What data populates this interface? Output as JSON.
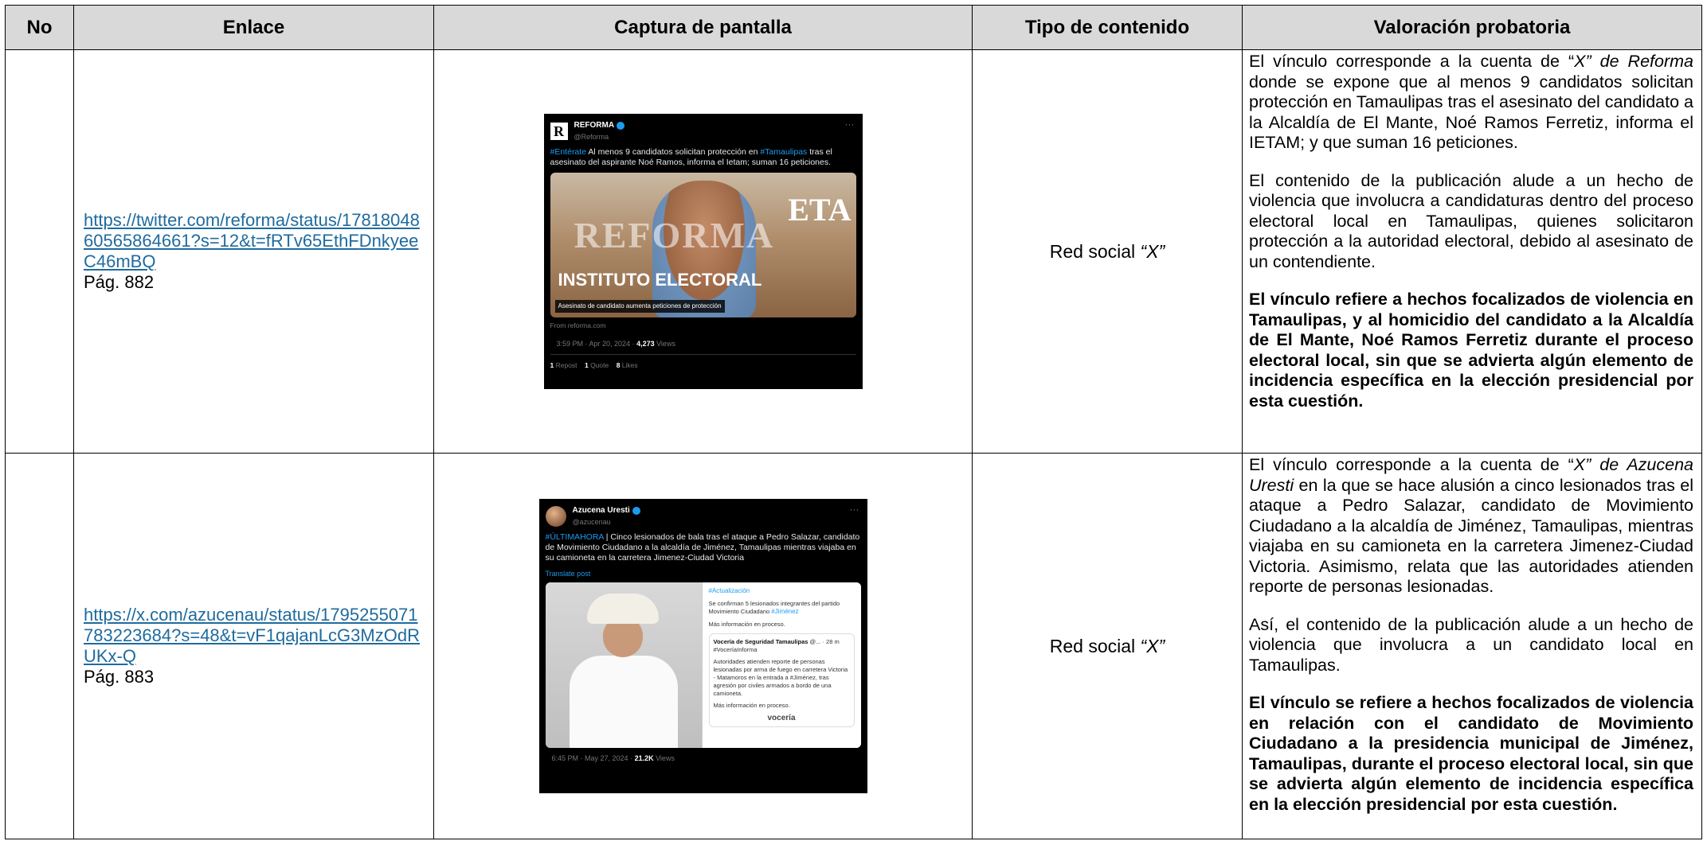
{
  "headers": {
    "no": "No",
    "enlace": "Enlace",
    "captura": "Captura de pantalla",
    "tipo": "Tipo de contenido",
    "valoracion": "Valoración probatoria"
  },
  "rows": [
    {
      "no": "",
      "link_line1": "https://twitter.com/reforma/status/17818",
      "link_line2": "04860565864661?s=12&t=fRTv65EthF",
      "link_line3": "DnkyeeC46mBQ",
      "page": "Pág. 882",
      "tipo_prefix": "Red social ",
      "tipo_em": "“X”",
      "p1_a": "El vínculo corresponde a la cuenta de “",
      "p1_em": "X” de Reforma",
      "p1_b": " donde se expone que al menos 9 candidatos solicitan protección en Tamaulipas tras el asesinato del candidato a la Alcaldía de El Mante, Noé Ramos Ferretiz, informa el IETAM; y que suman 16 peticiones.",
      "p2": "El contenido de la publicación alude a un hecho de violencia que involucra a candidaturas dentro del proceso electoral local en Tamaulipas, quienes solicitaron protección a la autoridad electoral, debido al asesinato de un contendiente.",
      "p3": "El vínculo refiere a hechos focalizados de violencia en Tamaulipas, y al homicidio del candidato a la Alcaldía de El Mante, Noé Ramos Ferretiz durante el proceso electoral local, sin que se advierta algún elemento de incidencia específica en la elección presidencial por esta cuestión.",
      "tweet": {
        "name": "REFORMA",
        "handle": "@Reforma",
        "tag1": "#Entérate",
        "text1": " Al menos 9 candidatos solicitan protección en ",
        "tag2": "#Tamaulipas",
        "text2": " tras el asesinato del aspirante Noé Ramos, informa el Ietam; suman 16 peticiones.",
        "wm_left": "REFORMA",
        "wm_right": "ETA",
        "wm_inst": "INSTITUTO ELECTORAL",
        "caption": "Asesinato de candidato aumenta peticiones de protección",
        "source": "From reforma.com",
        "time": "3:59 PM · Apr 20, 2024 · ",
        "views_num": "4,273",
        "views_label": " Views",
        "reposts_num": "1",
        "reposts_label": " Repost",
        "quotes_num": "1",
        "quotes_label": " Quote",
        "likes_num": "8",
        "likes_label": " Likes"
      }
    },
    {
      "no": "",
      "link_line1": "https://x.com/azucenau/status/1795255",
      "link_line2": "071783223684?s=48&t=vF1qajanLcG3",
      "link_line3": "MzOdRUKx-Q",
      "page": "Pág. 883",
      "tipo_prefix": "Red social ",
      "tipo_em": "“X”",
      "p1_a": "El vínculo corresponde a la cuenta de “",
      "p1_em": "X” de Azucena Uresti",
      "p1_b": " en la que se hace alusión a cinco lesionados tras el ataque a Pedro Salazar, candidato de Movimiento Ciudadano a la alcaldía de Jiménez, Tamaulipas, mientras viajaba en su camioneta en la carretera Jimenez-Ciudad Victoria. Asimismo, relata que las autoridades atienden reporte de personas lesionadas.",
      "p2": "Así, el contenido de la publicación alude a un hecho de violencia que involucra a un candidato local en Tamaulipas.",
      "p3": "El vínculo se refiere a hechos focalizados de violencia en relación con el candidato de Movimiento Ciudadano a la presidencia municipal de Jiménez, Tamaulipas, durante el proceso electoral local, sin que se advierta algún elemento de incidencia específica en la elección presidencial por esta cuestión.",
      "tweet": {
        "name": "Azucena Uresti",
        "handle": "@azucenau",
        "tag1": "#ÚLTIMAHORA",
        "text1": " | Cinco lesionados de bala tras el ataque a Pedro Salazar, candidato de Movimiento Ciudadano a la alcaldía de Jiménez, Tamaulipas mientras viajaba en su camioneta en la carretera Jimenez-Ciudad Victoria",
        "translate": "Translate post",
        "card_tag": "#Actualización",
        "card_text1": "Se confirman 5 lesionados integrantes del partido Movimiento Ciudadano ",
        "card_tag2": "#Jiménez",
        "card_text2": "Más información en proceso.",
        "sub_name": "Vocería de Seguridad Tamaulipas",
        "sub_time": " @... · 28 m",
        "sub_tag": "#VoceríaInforma",
        "sub_text": "Autoridades atienden reporte de personas lesionadas por arma de fuego en carretera Victoria - Matamoros en la entrada a #Jiménez, tras agresión por civiles armados a bordo de una camioneta.",
        "sub_more": "Más información en proceso.",
        "sub_logo": "vocería",
        "time": "6:45 PM · May 27, 2024 · ",
        "views_num": "21.2K",
        "views_label": " Views"
      }
    }
  ]
}
